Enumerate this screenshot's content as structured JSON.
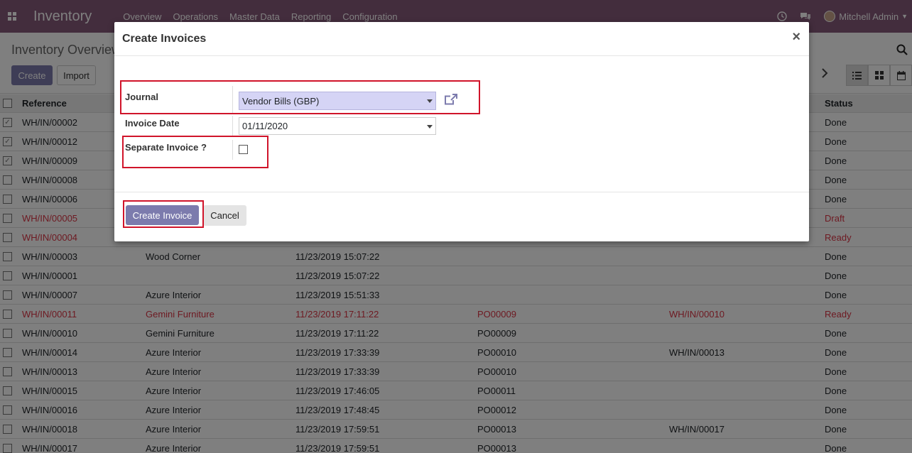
{
  "navbar": {
    "app_title": "Inventory",
    "menu": [
      "Overview",
      "Operations",
      "Master Data",
      "Reporting",
      "Configuration"
    ],
    "user_name": "Mitchell Admin",
    "bg_color": "#875A7B"
  },
  "control_panel": {
    "breadcrumb": "Inventory Overview",
    "create_label": "Create",
    "import_label": "Import"
  },
  "list": {
    "headers": {
      "reference": "Reference",
      "status": "Status"
    },
    "rows": [
      {
        "ref": "WH/IN/00002",
        "partner": "",
        "date": "",
        "source": "",
        "backorder": "",
        "status": "Done",
        "checked": true,
        "red": false
      },
      {
        "ref": "WH/IN/00012",
        "partner": "",
        "date": "",
        "source": "",
        "backorder": "",
        "status": "Done",
        "checked": true,
        "red": false
      },
      {
        "ref": "WH/IN/00009",
        "partner": "",
        "date": "",
        "source": "",
        "backorder": "",
        "status": "Done",
        "checked": true,
        "red": false
      },
      {
        "ref": "WH/IN/00008",
        "partner": "",
        "date": "",
        "source": "",
        "backorder": "",
        "status": "Done",
        "checked": false,
        "red": false
      },
      {
        "ref": "WH/IN/00006",
        "partner": "",
        "date": "",
        "source": "",
        "backorder": "",
        "status": "Done",
        "checked": false,
        "red": false
      },
      {
        "ref": "WH/IN/00005",
        "partner": "",
        "date": "",
        "source": "",
        "backorder": "",
        "status": "Draft",
        "checked": false,
        "red": true
      },
      {
        "ref": "WH/IN/00004",
        "partner": "",
        "date": "",
        "source": "",
        "backorder": "",
        "status": "Ready",
        "checked": false,
        "red": true
      },
      {
        "ref": "WH/IN/00003",
        "partner": "Wood Corner",
        "date": "11/23/2019 15:07:22",
        "source": "",
        "backorder": "",
        "status": "Done",
        "checked": false,
        "red": false
      },
      {
        "ref": "WH/IN/00001",
        "partner": "",
        "date": "11/23/2019 15:07:22",
        "source": "",
        "backorder": "",
        "status": "Done",
        "checked": false,
        "red": false
      },
      {
        "ref": "WH/IN/00007",
        "partner": "Azure Interior",
        "date": "11/23/2019 15:51:33",
        "source": "",
        "backorder": "",
        "status": "Done",
        "checked": false,
        "red": false
      },
      {
        "ref": "WH/IN/00011",
        "partner": "Gemini Furniture",
        "date": "11/23/2019 17:11:22",
        "source": "PO00009",
        "backorder": "WH/IN/00010",
        "status": "Ready",
        "checked": false,
        "red": true
      },
      {
        "ref": "WH/IN/00010",
        "partner": "Gemini Furniture",
        "date": "11/23/2019 17:11:22",
        "source": "PO00009",
        "backorder": "",
        "status": "Done",
        "checked": false,
        "red": false
      },
      {
        "ref": "WH/IN/00014",
        "partner": "Azure Interior",
        "date": "11/23/2019 17:33:39",
        "source": "PO00010",
        "backorder": "WH/IN/00013",
        "status": "Done",
        "checked": false,
        "red": false
      },
      {
        "ref": "WH/IN/00013",
        "partner": "Azure Interior",
        "date": "11/23/2019 17:33:39",
        "source": "PO00010",
        "backorder": "",
        "status": "Done",
        "checked": false,
        "red": false
      },
      {
        "ref": "WH/IN/00015",
        "partner": "Azure Interior",
        "date": "11/23/2019 17:46:05",
        "source": "PO00011",
        "backorder": "",
        "status": "Done",
        "checked": false,
        "red": false
      },
      {
        "ref": "WH/IN/00016",
        "partner": "Azure Interior",
        "date": "11/23/2019 17:48:45",
        "source": "PO00012",
        "backorder": "",
        "status": "Done",
        "checked": false,
        "red": false
      },
      {
        "ref": "WH/IN/00018",
        "partner": "Azure Interior",
        "date": "11/23/2019 17:59:51",
        "source": "PO00013",
        "backorder": "WH/IN/00017",
        "status": "Done",
        "checked": false,
        "red": false
      },
      {
        "ref": "WH/IN/00017",
        "partner": "Azure Interior",
        "date": "11/23/2019 17:59:51",
        "source": "PO00013",
        "backorder": "",
        "status": "Done",
        "checked": false,
        "red": false
      }
    ]
  },
  "modal": {
    "title": "Create Invoices",
    "close_symbol": "×",
    "journal_label": "Journal",
    "journal_value": "Vendor Bills (GBP)",
    "invoice_date_label": "Invoice Date",
    "invoice_date_value": "01/11/2020",
    "separate_invoice_label": "Separate Invoice ?",
    "separate_invoice_checked": false,
    "create_invoice_label": "Create Invoice",
    "cancel_label": "Cancel"
  },
  "colors": {
    "primary": "#7C7BAD",
    "highlight_box": "#d0142a",
    "danger_text": "#dc3545"
  }
}
